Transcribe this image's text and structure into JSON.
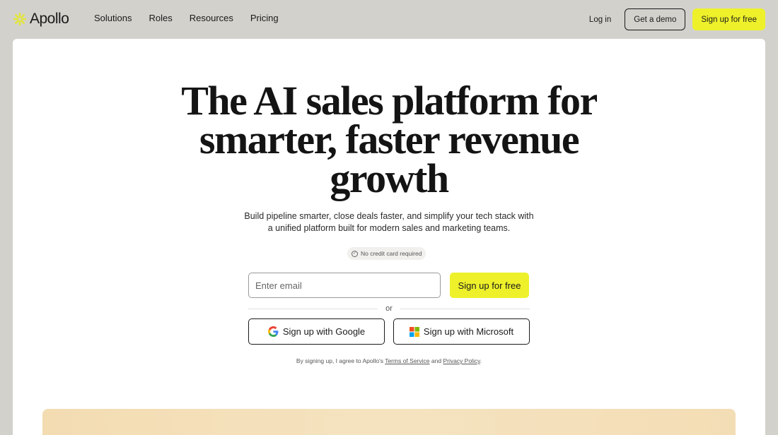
{
  "brand": {
    "name": "Apollo",
    "accent": "#eef12a"
  },
  "nav": {
    "links": [
      "Solutions",
      "Roles",
      "Resources",
      "Pricing"
    ],
    "login": "Log in",
    "demo": "Get a demo",
    "signup": "Sign up for free"
  },
  "hero": {
    "headline_lines": [
      "The AI sales platform for",
      "smarter, faster revenue",
      "growth"
    ],
    "subtext_lines": [
      "Build pipeline smarter, close deals faster, and simplify your tech stack with",
      "a unified platform built for modern sales and marketing teams."
    ],
    "badge": "No credit card required"
  },
  "signup_form": {
    "email_placeholder": "Enter email",
    "submit": "Sign up for free",
    "or": "or",
    "google": "Sign up with Google",
    "microsoft": "Sign up with Microsoft"
  },
  "legal": {
    "prefix": "By signing up, I agree to Apollo's",
    "terms": "Terms of Service",
    "and": "and",
    "privacy": "Privacy Policy",
    "suffix": "."
  }
}
